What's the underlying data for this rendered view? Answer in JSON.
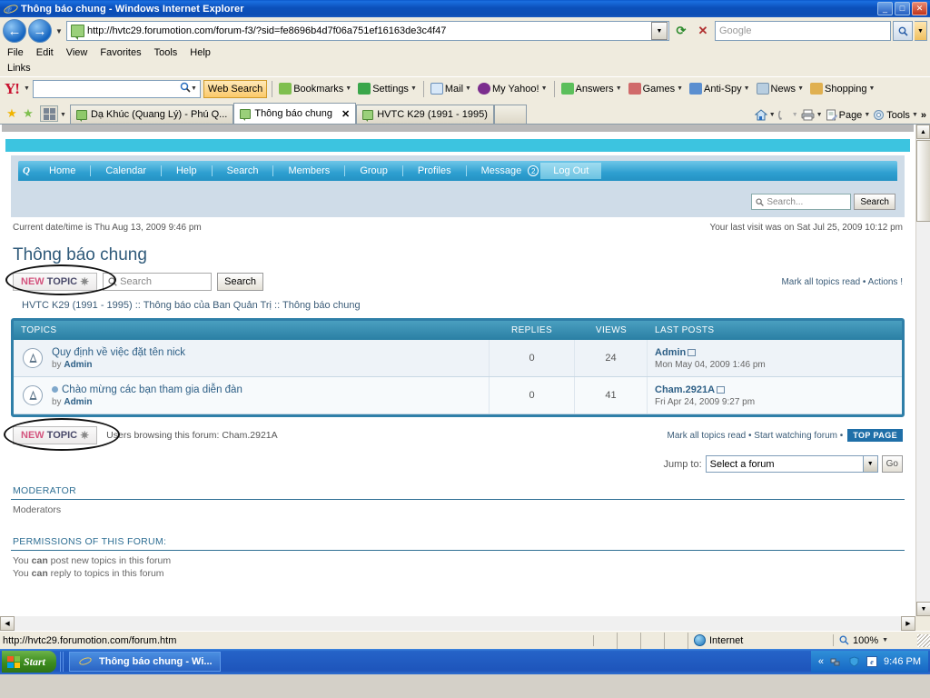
{
  "window": {
    "title": "Thông báo chung - Windows Internet Explorer",
    "minimize": "_",
    "maximize": "□",
    "close": "✕"
  },
  "address_bar": {
    "url": "http://hvtc29.forumotion.com/forum-f3/?sid=fe8696b4d7f06a751ef16163de3c4f47",
    "dropdown_caret": "▼",
    "refresh_icon": "refresh-icon",
    "stop_icon": "✕",
    "search_placeholder": "Google",
    "search_value": "Google",
    "search_go": "🔍",
    "search_caret": "▼"
  },
  "menu": {
    "items": [
      "File",
      "Edit",
      "View",
      "Favorites",
      "Tools",
      "Help"
    ],
    "links_label": "Links"
  },
  "yahoo_toolbar": {
    "logo": "Y!",
    "logo_caret": "▼",
    "search_value": "",
    "web_search": "Web Search",
    "items": [
      {
        "label": "Bookmarks",
        "caret": "▼",
        "color": "#7fbf4f"
      },
      {
        "label": "Settings",
        "caret": "▼",
        "color": "#3aa64a"
      },
      {
        "label": "Mail",
        "caret": "▼",
        "color": "#d8e8f8"
      },
      {
        "label": "My Yahoo!",
        "caret": "▼",
        "color": "#7b2d8e"
      },
      {
        "label": "Answers",
        "caret": "▼",
        "color": "#5bbf5b"
      },
      {
        "label": "Games",
        "caret": "▼",
        "color": "#d06a6a"
      },
      {
        "label": "Anti-Spy",
        "caret": "▼",
        "color": "#5b8fd0"
      },
      {
        "label": "News",
        "caret": "▼",
        "color": "#b8cee0"
      },
      {
        "label": "Shopping",
        "caret": "▼",
        "color": "#e0b050"
      }
    ]
  },
  "tabs": {
    "favorites_star": "★",
    "add_favorite": "★",
    "quick_tabs": "quick-tabs-icon",
    "quick_caret": "▼",
    "items": [
      {
        "label": "Dạ Khúc (Quang Lý) - Phú Q...",
        "active": false
      },
      {
        "label": "Thông báo chung",
        "active": true,
        "close": "✕"
      },
      {
        "label": "HVTC K29 (1991 - 1995)",
        "active": false
      }
    ],
    "right_tools": [
      {
        "name": "home-icon",
        "label": ""
      },
      {
        "name": "feeds-icon",
        "label": ""
      },
      {
        "name": "print-icon",
        "label": ""
      },
      {
        "name": "page-menu",
        "label": "Page"
      },
      {
        "name": "tools-menu",
        "label": "Tools"
      }
    ],
    "overflow": "»"
  },
  "forum": {
    "nav": {
      "logo": "Q",
      "items": [
        "Home",
        "Calendar",
        "Help",
        "Search",
        "Members",
        "Group",
        "Profiles",
        "Message"
      ],
      "message_badge": "2",
      "logout": "Log Out"
    },
    "header_search": {
      "placeholder": "Search...",
      "button": "Search",
      "icon": "search-icon"
    },
    "current_datetime": "Current date/time is Thu Aug 13, 2009 9:46 pm",
    "last_visit": "Your last visit was on Sat Jul 25, 2009 10:12 pm",
    "page_title": "Thông báo chung",
    "new_topic": {
      "new": "NEW",
      "topic": "TOPIC",
      "star": "✷"
    },
    "topic_search": {
      "placeholder": "Search",
      "button": "Search",
      "icon": "search-icon"
    },
    "top_links": "Mark all topics read • Actions !",
    "breadcrumb": "HVTC K29 (1991 - 1995) :: Thông báo của Ban Quản Trị :: Thông báo chung",
    "table": {
      "headers": {
        "topics": "TOPICS",
        "replies": "REPLIES",
        "views": "VIEWS",
        "last_posts": "LAST POSTS"
      },
      "rows": [
        {
          "icon": "announcement-icon",
          "bullet": false,
          "title": "Quy định về việc đặt tên nick",
          "by_prefix": "by",
          "by_author": "Admin",
          "replies": "0",
          "views": "24",
          "last_author": "Admin",
          "last_date": "Mon May 04, 2009 1:46 pm"
        },
        {
          "icon": "announcement-icon",
          "bullet": true,
          "title": "Chào mừng các bạn tham gia diễn đàn",
          "by_prefix": "by",
          "by_author": "Admin",
          "replies": "0",
          "views": "41",
          "last_author": "Cham.2921A",
          "last_date": "Fri Apr 24, 2009 9:27 pm"
        }
      ]
    },
    "users_browsing": "Users browsing this forum: Cham.2921A",
    "bottom_links": "Mark all topics read • Start watching forum •",
    "top_page": "TOP PAGE",
    "jump_to": {
      "label": "Jump to:",
      "selected": "Select a forum",
      "caret": "▼",
      "go": "Go"
    },
    "moderator": {
      "heading": "MODERATOR",
      "value": "Moderators"
    },
    "permissions": {
      "heading": "PERMISSIONS OF THIS FORUM:",
      "lines": [
        {
          "pre": "You ",
          "strong": "can",
          "post": " post new topics in this forum"
        },
        {
          "pre": "You ",
          "strong": "can",
          "post": " reply to topics in this forum"
        }
      ]
    }
  },
  "status_bar": {
    "url": "http://hvtc29.forumotion.com/forum.htm",
    "zone": "Internet",
    "zone_icon": "globe-icon",
    "zoom": "100%",
    "zoom_caret": "▼",
    "zoom_icon": "zoom-icon"
  },
  "taskbar": {
    "start": "Start",
    "items": [
      {
        "label": "Thông báo chung - Wi..."
      }
    ],
    "tray_expand": "«",
    "clock": "9:46 PM",
    "tray_icons": [
      "network-icon",
      "shield-icon",
      "ie-icon"
    ]
  },
  "colors": {
    "title_blue": "#0d4eb4",
    "forum_cyan": "#3cc4e0",
    "forum_header": "#2a7fa4",
    "link_blue": "#2d5f86",
    "newtopic_pink": "#d4557f"
  }
}
